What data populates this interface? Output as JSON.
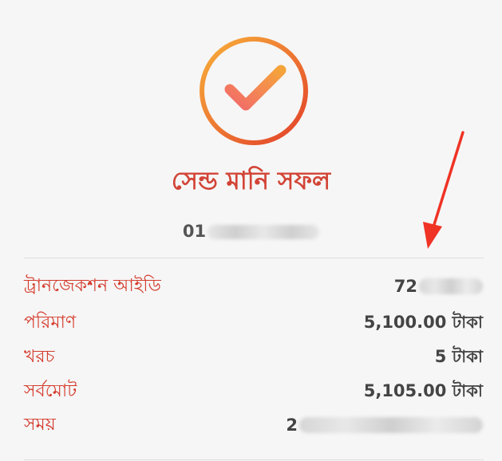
{
  "colors": {
    "accent": "#d43a2b",
    "ring_start": "#f6a23a",
    "ring_end": "#e5422a",
    "annotation_arrow": "#ef3325"
  },
  "icons": {
    "success": "check-circle-icon",
    "annotation": "red-arrow-icon"
  },
  "status": {
    "title": "সেন্ড মানি সফল"
  },
  "recipient": {
    "phone_visible": "01"
  },
  "details": {
    "transaction_id": {
      "label": "ট্রানজেকশন আইডি",
      "value_visible": "72"
    },
    "amount": {
      "label": "পরিমাণ",
      "value": "5,100.00 টাকা"
    },
    "fee": {
      "label": "খরচ",
      "value": "5 টাকা"
    },
    "total": {
      "label": "সর্বমোট",
      "value": "5,105.00 টাকা"
    },
    "time": {
      "label": "সময়",
      "value_visible": "2"
    }
  }
}
